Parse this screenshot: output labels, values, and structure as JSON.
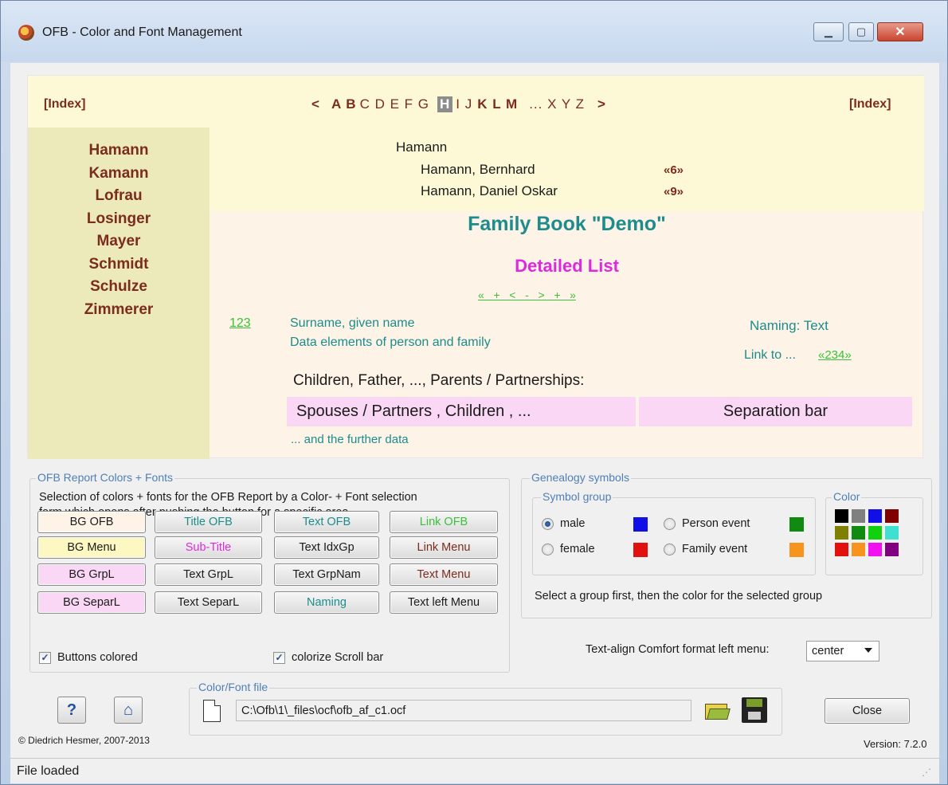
{
  "window": {
    "title": "OFB - Color and Font Management"
  },
  "preview": {
    "index_left": "[Index]",
    "index_right": "[Index]",
    "nav_prev": "<",
    "letters_a": "A B",
    "letters_c": "C D E F G",
    "letter_current": "H",
    "letters_ij": "I J",
    "letters_klm": "K L M",
    "letters_dots": "... X Y Z",
    "nav_next": ">",
    "left_menu": [
      "Hamann",
      "Kamann",
      "Lofrau",
      "Losinger",
      "Mayer",
      "Schmidt",
      "Schulze",
      "Zimmerer"
    ],
    "group_name": "Hamann",
    "persons": [
      {
        "name": "Hamann, Bernhard",
        "ref": "«6»"
      },
      {
        "name": "Hamann, Daniel Oskar",
        "ref": "«9»"
      }
    ],
    "title": "Family Book \"Demo\"",
    "subtitle": "Detailed List",
    "nav_links": "«   +   <   -   >   +   »",
    "link_number": "123",
    "surname_line": "Surname, given name",
    "data_line": "Data elements of person and family",
    "naming": "Naming: Text",
    "link_to": "Link to ...",
    "link_ref": "«234»",
    "children_header": "Children, Father, ..., Parents / Partnerships:",
    "spouses": "Spouses / Partners , Children , ...",
    "separation_bar": "Separation bar",
    "further": "... and the further data"
  },
  "report": {
    "group_label": "OFB Report Colors + Fonts",
    "description_1": "Selection of colors + fonts for the OFB Report by a Color- + Font selection",
    "description_2": "form which opens after pushing the button for a specific area",
    "buttons": [
      {
        "label": "BG OFB",
        "bg": "#fdf3e7",
        "color": "#1b1b1b"
      },
      {
        "label": "Title OFB",
        "bg": "",
        "color": "#1d8c8c"
      },
      {
        "label": "Text OFB",
        "bg": "",
        "color": "#1d8c8c"
      },
      {
        "label": "Link OFB",
        "bg": "",
        "color": "#39c139"
      },
      {
        "label": "BG Menu",
        "bg": "#fdf8c2",
        "color": "#1b1b1b"
      },
      {
        "label": "Sub-Title",
        "bg": "",
        "color": "#df29df"
      },
      {
        "label": "Text IdxGp",
        "bg": "",
        "color": "#1b1b1b"
      },
      {
        "label": "Link Menu",
        "bg": "",
        "color": "#7b2c1d"
      },
      {
        "label": "BG GrpL",
        "bg": "#fbd7f6",
        "color": "#1b1b1b"
      },
      {
        "label": "Text GrpL",
        "bg": "",
        "color": "#1b1b1b"
      },
      {
        "label": "Text GrpNam",
        "bg": "",
        "color": "#1b1b1b"
      },
      {
        "label": "Text Menu",
        "bg": "",
        "color": "#7b2c1d"
      },
      {
        "label": "BG SeparL",
        "bg": "#fbd7f6",
        "color": "#1b1b1b"
      },
      {
        "label": "Text SeparL",
        "bg": "",
        "color": "#1b1b1b"
      },
      {
        "label": "Naming",
        "bg": "",
        "color": "#1d8c8c"
      },
      {
        "label": "Text left Menu",
        "bg": "",
        "color": "#1b1b1b"
      }
    ],
    "buttons_colored": "Buttons colored",
    "colorize_scroll": "colorize Scroll bar"
  },
  "genealogy": {
    "group_label": "Genealogy symbols",
    "symbol_group_label": "Symbol group",
    "color_label": "Color",
    "male": "male",
    "female": "female",
    "person_event": "Person event",
    "family_event": "Family event",
    "hint": "Select a group first, then the color for the selected group",
    "colors": {
      "male": "#1010e6",
      "female": "#e31010",
      "person_event": "#108a10",
      "family_event": "#f7941d"
    },
    "palette": [
      "#000000",
      "#808080",
      "#1010e6",
      "#800000",
      "#808000",
      "#108a10",
      "#10d010",
      "#40e0d0",
      "#e31010",
      "#f7941d",
      "#f010f0",
      "#800080"
    ]
  },
  "textalign": {
    "label": "Text-align Comfort format left menu:",
    "value": "center"
  },
  "file": {
    "group_label": "Color/Font file",
    "path": "C:\\Ofb\\1\\_files\\ocf\\ofb_af_c1.ocf"
  },
  "footer": {
    "copyright": "© Diedrich Hesmer,  2007-2013",
    "version": "Version: 7.2.0",
    "close_label": "Close",
    "help_label": "?"
  },
  "status": {
    "text": "File loaded"
  }
}
